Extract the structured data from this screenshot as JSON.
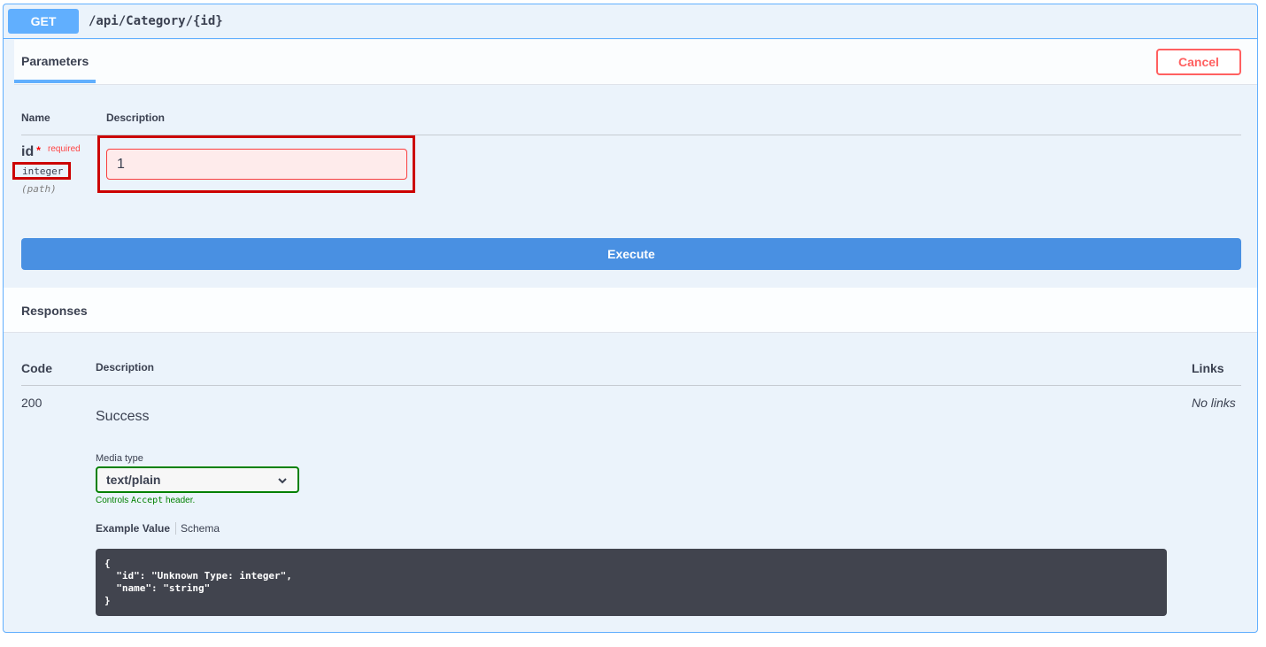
{
  "summary": {
    "method": "GET",
    "path": "/api/Category/{id}"
  },
  "parameters": {
    "tab_label": "Parameters",
    "cancel_label": "Cancel",
    "col_name": "Name",
    "col_description": "Description",
    "param": {
      "name": "id",
      "star": "*",
      "required": "required",
      "type": "integer",
      "in": "(path)",
      "value": "1"
    },
    "execute_label": "Execute"
  },
  "responses": {
    "title": "Responses",
    "col_code": "Code",
    "col_description": "Description",
    "col_links": "Links",
    "row": {
      "code": "200",
      "description": "Success",
      "links": "No links"
    },
    "media_type_label": "Media type",
    "media_type_value": "text/plain",
    "controls_prefix": "Controls",
    "controls_code": "Accept",
    "controls_suffix": "header.",
    "example_tab": "Example Value",
    "schema_tab": "Schema",
    "example_body": "{\n  \"id\": \"Unknown Type: integer\",\n  \"name\": \"string\"\n}"
  },
  "colors": {
    "get_blue": "#61affe",
    "execute_blue": "#4990e2",
    "cancel_red": "#ff6060",
    "highlight_red": "#cc0000",
    "media_green": "#008000"
  }
}
